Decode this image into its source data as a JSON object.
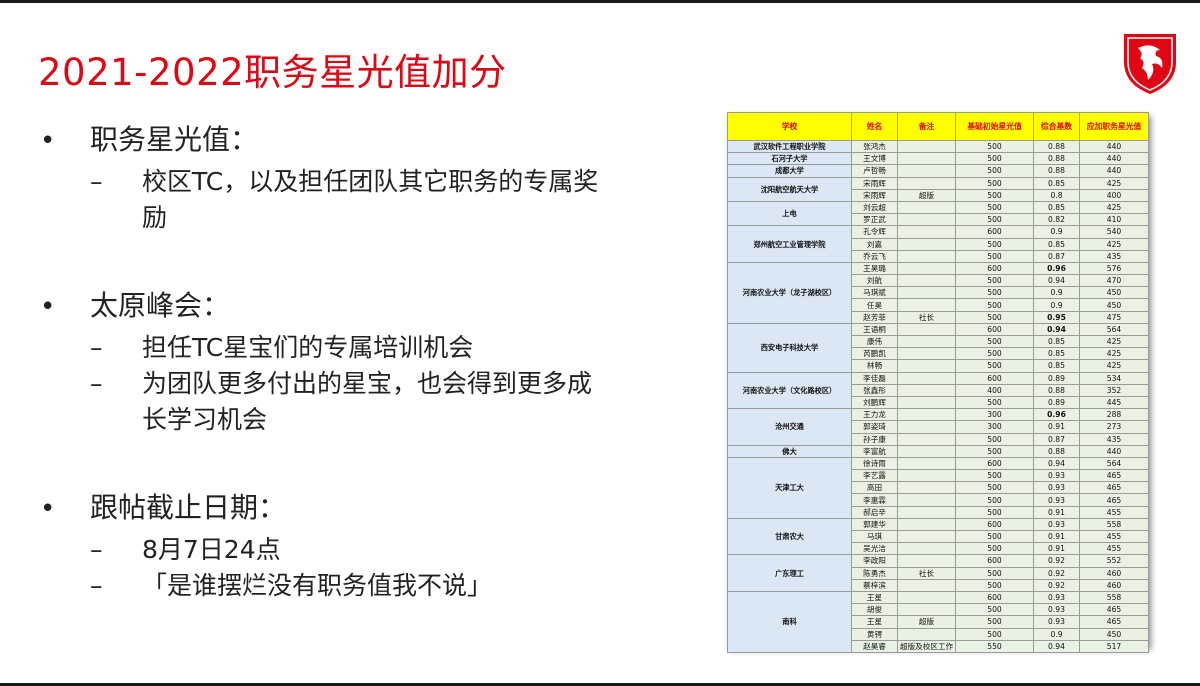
{
  "title": "2021-2022职务星光值加分",
  "logo": {
    "icon": "dragon-shield-icon",
    "color": "#e10613"
  },
  "bullets": [
    {
      "text": "职务星光值：",
      "subs": [
        "校区TC，以及担任团队其它职务的专属奖励"
      ]
    },
    {
      "text": "太原峰会：",
      "subs": [
        "担任TC星宝们的专属培训机会",
        "为团队更多付出的星宝，也会得到更多成长学习机会"
      ]
    },
    {
      "text": "跟帖截止日期：",
      "subs": [
        "8月7日24点",
        "「是谁摆烂没有职务值我不说」"
      ]
    }
  ],
  "table": {
    "headers": [
      "学校",
      "姓名",
      "备注",
      "基础初始星光值",
      "综合基数",
      "应加职务星光值"
    ],
    "groups": [
      {
        "school": "武汉软件工程职业学院",
        "rows": [
          [
            "张鸿杰",
            "",
            "500",
            "0.88",
            "440"
          ]
        ]
      },
      {
        "school": "石河子大学",
        "rows": [
          [
            "王文博",
            "",
            "500",
            "0.88",
            "440"
          ]
        ]
      },
      {
        "school": "成都大学",
        "rows": [
          [
            "卢哲畅",
            "",
            "500",
            "0.88",
            "440"
          ]
        ]
      },
      {
        "school": "沈阳航空航天大学",
        "rows": [
          [
            "宋雨辉",
            "",
            "500",
            "0.85",
            "425"
          ],
          [
            "宋雨辉",
            "超版",
            "500",
            "0.8",
            "400"
          ]
        ]
      },
      {
        "school": "上电",
        "rows": [
          [
            "刘云超",
            "",
            "500",
            "0.85",
            "425"
          ],
          [
            "罗正武",
            "",
            "500",
            "0.82",
            "410"
          ]
        ]
      },
      {
        "school": "郑州航空工业管理学院",
        "rows": [
          [
            "孔令辉",
            "",
            "600",
            "0.9",
            "540"
          ],
          [
            "刘嘉",
            "",
            "500",
            "0.85",
            "425"
          ],
          [
            "乔云飞",
            "",
            "500",
            "0.87",
            "435"
          ]
        ]
      },
      {
        "school": "河南农业大学（龙子湖校区）",
        "rows": [
          [
            "王昊璐",
            "",
            "600",
            "0.96",
            "576"
          ],
          [
            "刘航",
            "",
            "500",
            "0.94",
            "470"
          ],
          [
            "马琪斌",
            "",
            "500",
            "0.9",
            "450"
          ],
          [
            "任昊",
            "",
            "500",
            "0.9",
            "450"
          ],
          [
            "赵芳菲",
            "社长",
            "500",
            "0.95",
            "475"
          ]
        ]
      },
      {
        "school": "西安电子科技大学",
        "rows": [
          [
            "王语桐",
            "",
            "600",
            "0.94",
            "564"
          ],
          [
            "康伟",
            "",
            "500",
            "0.85",
            "425"
          ],
          [
            "芮鹏凯",
            "",
            "500",
            "0.85",
            "425"
          ],
          [
            "林畅",
            "",
            "500",
            "0.85",
            "425"
          ]
        ]
      },
      {
        "school": "河南农业大学（文化路校区）",
        "rows": [
          [
            "李佳磊",
            "",
            "600",
            "0.89",
            "534"
          ],
          [
            "张鑫彤",
            "",
            "400",
            "0.88",
            "352"
          ],
          [
            "刘鹏辉",
            "",
            "500",
            "0.89",
            "445"
          ]
        ]
      },
      {
        "school": "沧州交通",
        "rows": [
          [
            "王力龙",
            "",
            "300",
            "0.96",
            "288"
          ],
          [
            "郭姿琦",
            "",
            "300",
            "0.91",
            "273"
          ],
          [
            "孙子康",
            "",
            "500",
            "0.87",
            "435"
          ]
        ]
      },
      {
        "school": "佛大",
        "rows": [
          [
            "李富航",
            "",
            "500",
            "0.88",
            "440"
          ]
        ]
      },
      {
        "school": "天津工大",
        "rows": [
          [
            "徐诗雨",
            "",
            "600",
            "0.94",
            "564"
          ],
          [
            "李艺露",
            "",
            "500",
            "0.93",
            "465"
          ],
          [
            "高田",
            "",
            "500",
            "0.93",
            "465"
          ],
          [
            "李惠霖",
            "",
            "500",
            "0.93",
            "465"
          ],
          [
            "郝启辛",
            "",
            "500",
            "0.91",
            "455"
          ]
        ]
      },
      {
        "school": "甘肃农大",
        "rows": [
          [
            "郭建华",
            "",
            "600",
            "0.93",
            "558"
          ],
          [
            "马琪",
            "",
            "500",
            "0.91",
            "455"
          ],
          [
            "吴光洁",
            "",
            "500",
            "0.91",
            "455"
          ]
        ]
      },
      {
        "school": "广东理工",
        "rows": [
          [
            "李政阳",
            "",
            "600",
            "0.92",
            "552"
          ],
          [
            "陈勇杰",
            "社长",
            "500",
            "0.92",
            "460"
          ],
          [
            "蔡梓滨",
            "",
            "500",
            "0.92",
            "460"
          ]
        ]
      },
      {
        "school": "南科",
        "rows": [
          [
            "王星",
            "",
            "600",
            "0.93",
            "558"
          ],
          [
            "胡俊",
            "",
            "500",
            "0.93",
            "465"
          ],
          [
            "王星",
            "超版",
            "500",
            "0.93",
            "465"
          ],
          [
            "黄锷",
            "",
            "500",
            "0.9",
            "450"
          ],
          [
            "赵昊睿",
            "超版及校区工作",
            "550",
            "0.94",
            "517"
          ]
        ]
      }
    ]
  }
}
